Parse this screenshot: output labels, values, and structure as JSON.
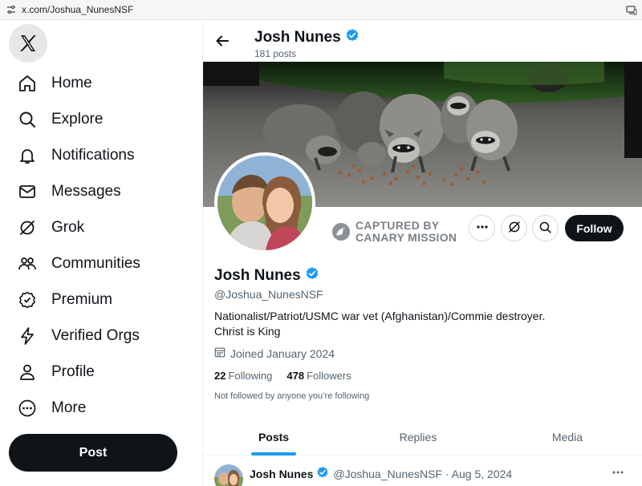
{
  "browser": {
    "url": "x.com/Joshua_NunesNSF"
  },
  "nav": {
    "items": [
      {
        "label": "Home",
        "icon": "home-icon"
      },
      {
        "label": "Explore",
        "icon": "search-icon"
      },
      {
        "label": "Notifications",
        "icon": "bell-icon"
      },
      {
        "label": "Messages",
        "icon": "envelope-icon"
      },
      {
        "label": "Grok",
        "icon": "grok-icon"
      },
      {
        "label": "Communities",
        "icon": "people-icon"
      },
      {
        "label": "Premium",
        "icon": "premium-badge-icon"
      },
      {
        "label": "Verified Orgs",
        "icon": "lightning-icon"
      },
      {
        "label": "Profile",
        "icon": "person-icon"
      },
      {
        "label": "More",
        "icon": "more-circle-icon"
      }
    ],
    "post_label": "Post"
  },
  "header": {
    "name": "Josh Nunes",
    "post_count": "181 posts"
  },
  "profile": {
    "name": "Josh Nunes",
    "handle": "@Joshua_NunesNSF",
    "bio_line1": "Nationalist/Patriot/USMC war vet (Afghanistan)/Commie destroyer.",
    "bio_line2": "Christ is King",
    "joined": "Joined January 2024",
    "following_count": "22",
    "following_label": "Following",
    "followers_count": "478",
    "followers_label": "Followers",
    "not_followed": "Not followed by anyone you’re following",
    "capture_line1": "CAPTURED BY",
    "capture_line2": "CANARY MISSION",
    "follow_label": "Follow"
  },
  "tabs": [
    {
      "label": "Posts",
      "active": true
    },
    {
      "label": "Replies",
      "active": false
    },
    {
      "label": "Media",
      "active": false
    }
  ],
  "post": {
    "name": "Josh Nunes",
    "meta": "@Joshua_NunesNSF · Aug 5, 2024"
  },
  "colors": {
    "verified": "#1d9bf0",
    "primary_button": "#0f1419",
    "accent": "#1d9bf0"
  }
}
